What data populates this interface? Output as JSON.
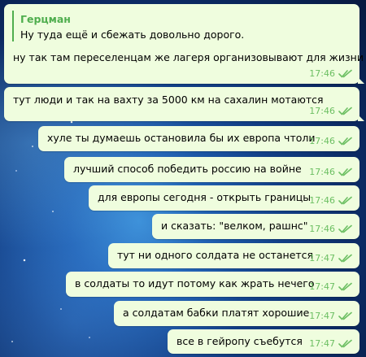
{
  "theme": {
    "bubble_color": "#effdde",
    "reply_accent": "#4fae4e",
    "time_color": "#6cbf62"
  },
  "messages": [
    {
      "reply": {
        "author": "Герцман",
        "text": "Ну туда ещё и сбежать довольно дорого."
      },
      "text": "ну так там переселенцам же лагеря организовывают для жизни",
      "time": "17:46",
      "status_icon": "double-check-icon"
    },
    {
      "text": "тут люди и так на вахту за 5000 км на сахалин мотаются",
      "time": "17:46",
      "status_icon": "double-check-icon"
    },
    {
      "text": "хуле ты думаешь остановила бы их европа чтоли",
      "time": "17:46",
      "status_icon": "double-check-icon"
    },
    {
      "text": "лучший способ победить россию на войне",
      "time": "17:46",
      "status_icon": "double-check-icon"
    },
    {
      "text": "для европы сегодня - открыть границы",
      "time": "17:46",
      "status_icon": "double-check-icon"
    },
    {
      "text": "и сказать: \"велком, рашнс\"",
      "time": "17:46",
      "status_icon": "double-check-icon"
    },
    {
      "text": "тут ни одного солдата не останется",
      "time": "17:47",
      "status_icon": "double-check-icon"
    },
    {
      "text": "в солдаты то идут потому как жрать нечего",
      "time": "17:47",
      "status_icon": "double-check-icon"
    },
    {
      "text": "а солдатам бабки платят хорошие",
      "time": "17:47",
      "status_icon": "double-check-icon"
    },
    {
      "text": "все в гейропу съебутся",
      "time": "17:47",
      "status_icon": "double-check-icon"
    }
  ]
}
